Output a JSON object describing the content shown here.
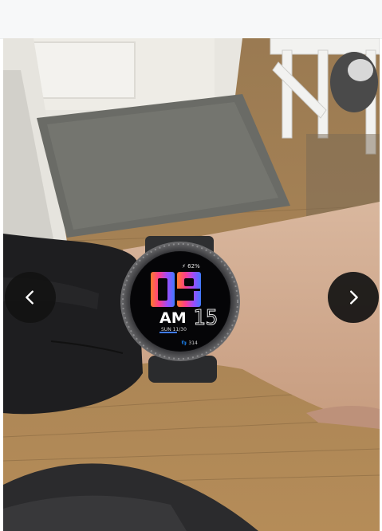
{
  "viewer": {
    "prev_icon": "chevron-left-icon",
    "next_icon": "chevron-right-icon"
  },
  "watch_face": {
    "battery": "⚡ 62%",
    "hour": "09",
    "ampm": "AM",
    "date": "SUN 11/30",
    "minute": "15",
    "steps": "👣 314"
  },
  "colors": {
    "nav_button": "#121212",
    "floor": "#a98452",
    "sleeve": "#1e1e1e"
  }
}
